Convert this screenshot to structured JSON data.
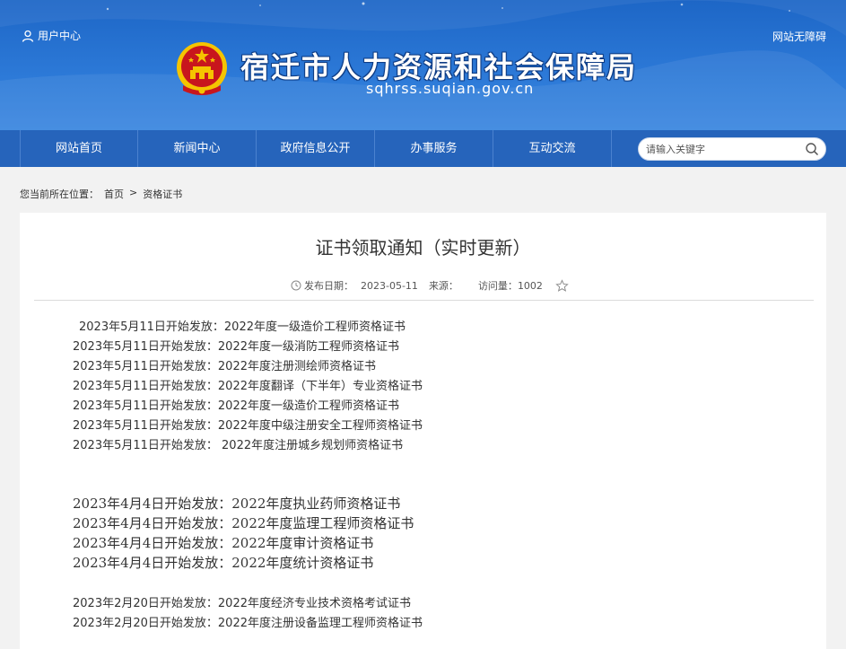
{
  "header": {
    "user_center": "用户中心",
    "accessibility": "网站无障碍",
    "site_title": "宿迁市人力资源和社会保障局",
    "site_domain": "sqhrss.suqian.gov.cn"
  },
  "nav": {
    "items": [
      "网站首页",
      "新闻中心",
      "政府信息公开",
      "办事服务",
      "互动交流"
    ],
    "search_placeholder": "请输入关键字"
  },
  "breadcrumb": {
    "label": "您当前所在位置：",
    "home": "首页",
    "separator": ">",
    "current": "资格证书"
  },
  "article": {
    "title": "证书领取通知（实时更新）",
    "publish_label": "发布日期：",
    "publish_date": "2023-05-11",
    "source_label": "来源：",
    "visits_label": "访问量：",
    "visits": "1002",
    "group1": [
      "2023年5月11日开始发放：2022年度一级造价工程师资格证书",
      "2023年5月11日开始发放：2022年度一级消防工程师资格证书",
      "2023年5月11日开始发放：2022年度注册测绘师资格证书",
      "2023年5月11日开始发放：2022年度翻译（下半年）专业资格证书",
      "2023年5月11日开始发放：2022年度一级造价工程师资格证书",
      "2023年5月11日开始发放：2022年度中级注册安全工程师资格证书",
      "2023年5月11日开始发放： 2022年度注册城乡规划师资格证书"
    ],
    "group2": [
      "2023年4月4日开始发放：2022年度执业药师资格证书",
      "2023年4月4日开始发放：2022年度监理工程师资格证书",
      "2023年4月4日开始发放：2022年度审计资格证书",
      "2023年4月4日开始发放：2022年度统计资格证书"
    ],
    "group3": [
      "2023年2月20日开始发放：2022年度经济专业技术资格考试证书",
      "2023年2月20日开始发放：2022年度注册设备监理工程师资格证书"
    ]
  },
  "colors": {
    "header_blue": "#2d7ad8",
    "nav_blue": "#2664bb",
    "emblem_red": "#c8161d",
    "emblem_gold": "#f5c400"
  }
}
